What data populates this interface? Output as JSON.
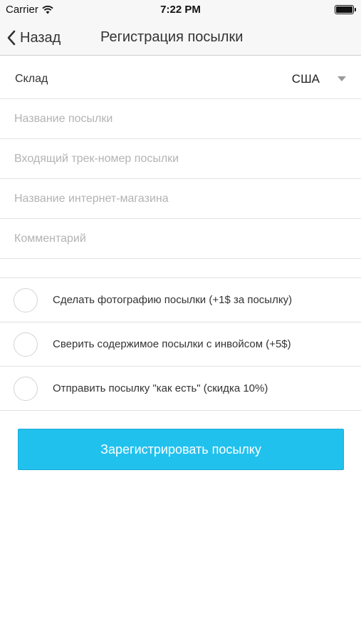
{
  "status_bar": {
    "carrier": "Carrier",
    "time": "7:22 PM",
    "battery_level": 1.0
  },
  "nav": {
    "back_label": "Назад",
    "title": "Регистрация посылки"
  },
  "form": {
    "warehouse": {
      "label": "Склад",
      "value": "США"
    },
    "fields": [
      {
        "placeholder": "Название посылки",
        "value": ""
      },
      {
        "placeholder": "Входящий трек-номер посылки",
        "value": ""
      },
      {
        "placeholder": "Название интернет-магазина",
        "value": ""
      },
      {
        "placeholder": "Комментарий",
        "value": ""
      }
    ],
    "options": [
      {
        "label": "Сделать фотографию посылки (+1$ за посылку)",
        "checked": false
      },
      {
        "label": "Сверить содержимое посылки с инвойсом (+5$)",
        "checked": false
      },
      {
        "label": "Отправить посылку \"как есть\" (скидка 10%)",
        "checked": false
      }
    ]
  },
  "submit_label": "Зарегистрировать посылку",
  "colors": {
    "accent": "#21c1ee",
    "nav_background": "#f7f7f7",
    "placeholder": "#b3b3b3"
  },
  "icons": {
    "back": "chevron-left-icon",
    "wifi": "wifi-icon",
    "battery": "battery-icon",
    "dropdown": "caret-down-icon"
  }
}
